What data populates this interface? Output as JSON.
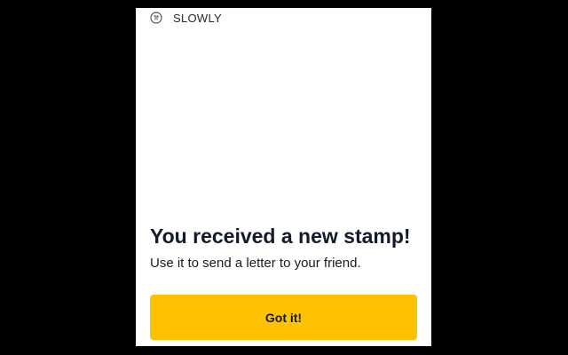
{
  "stamp": {
    "label": "SLOWLY",
    "icon": "slowly-stamp-icon"
  },
  "dialog": {
    "title": "You received a new stamp!",
    "message": "Use it to send a letter to your friend.",
    "button_label": "Got it!"
  },
  "colors": {
    "background": "#000000",
    "screen": "#ffffff",
    "accent": "#ffc200",
    "text_dark": "#121a2e"
  }
}
